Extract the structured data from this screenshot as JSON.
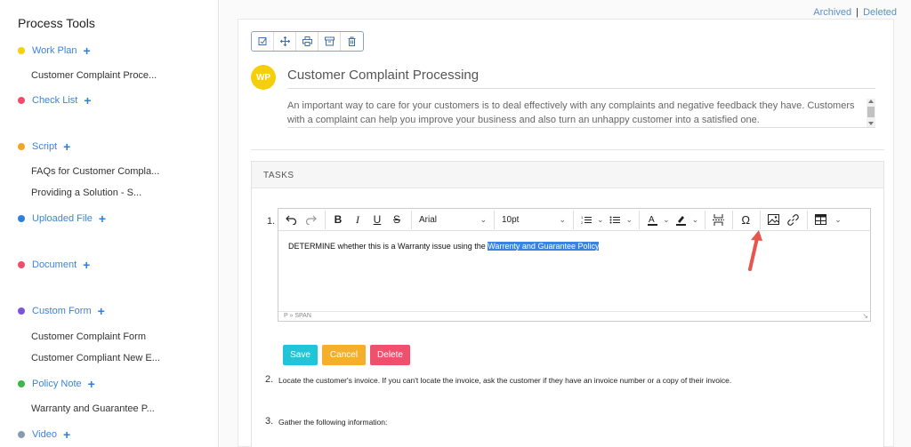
{
  "sidebar": {
    "title": "Process Tools",
    "categories": [
      {
        "label": "Work Plan",
        "color": "#f5d10b",
        "items": [
          "Customer Complaint Proce..."
        ]
      },
      {
        "label": "Check List",
        "color": "#ef4c6e",
        "items": []
      },
      {
        "label": "Script",
        "color": "#f4a623",
        "items": [
          "FAQs for Customer Compla...",
          "Providing a Solution - S..."
        ]
      },
      {
        "label": "Uploaded File",
        "color": "#2e7fd8",
        "items": []
      },
      {
        "label": "Document",
        "color": "#ef4c6e",
        "items": []
      },
      {
        "label": "Custom Form",
        "color": "#7a55d8",
        "items": [
          "Customer Complaint Form",
          "Customer Compliant New E..."
        ]
      },
      {
        "label": "Policy Note",
        "color": "#3cb54a",
        "items": [
          "Warranty and Guarantee P..."
        ]
      },
      {
        "label": "Video",
        "color": "#8a9bb0",
        "items": []
      }
    ],
    "plus": "+"
  },
  "header": {
    "archived": "Archived",
    "separator": "|",
    "deleted": "Deleted"
  },
  "toolbar": {
    "icons": [
      "edit-icon",
      "move-icon",
      "print-icon",
      "archive-icon",
      "trash-icon"
    ]
  },
  "doc": {
    "avatar": "WP",
    "title": "Customer Complaint Processing",
    "description": "An important way to care for your customers is to deal effectively with any complaints and negative feedback they have. Customers with a complaint can help you improve your business and also turn an unhappy customer into a satisfied one."
  },
  "tasks": {
    "header": "TASKS",
    "editor": {
      "font": "Arial",
      "size": "10pt",
      "text_before": "DETERMINE whether this is a Warranty issue using the ",
      "text_selected": "Warrenty and Guarantee Policy",
      "status": "P » SPAN"
    },
    "buttons": {
      "save": "Save",
      "cancel": "Cancel",
      "delete": "Delete"
    },
    "items": [
      {
        "num": "1.",
        "text": ""
      },
      {
        "num": "2.",
        "text": "Locate the customer's invoice. If you can't locate the invoice, ask the customer if they have an invoice number or a copy of their invoice."
      },
      {
        "num": "3.",
        "text": "Gather the following information:"
      }
    ]
  },
  "colors": {
    "accent": "#3b84d8",
    "selection": "#3a84e0",
    "arrow": "#e8554a"
  }
}
